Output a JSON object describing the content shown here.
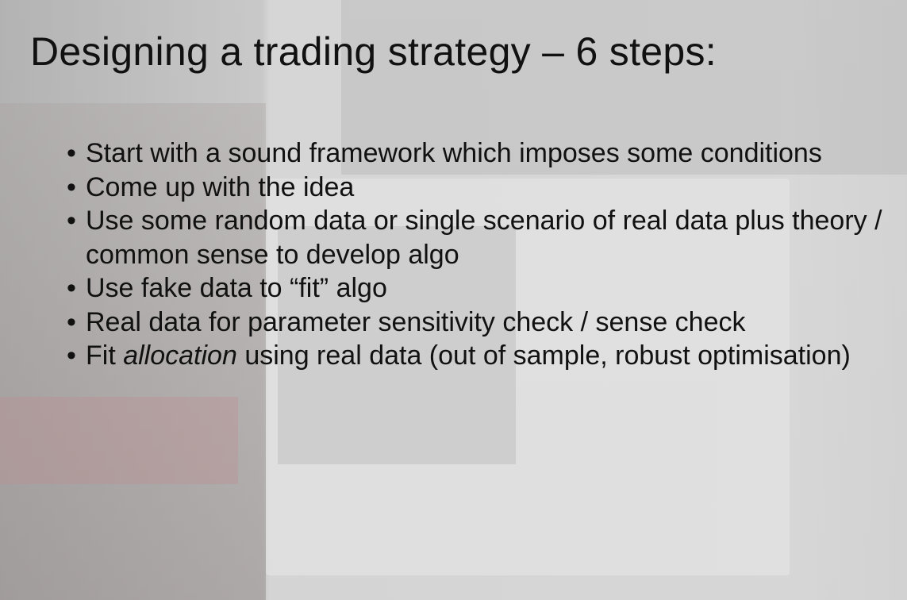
{
  "slide": {
    "title": "Designing a trading strategy – 6 steps:",
    "bullets": [
      {
        "text": "Start with a sound framework which imposes some conditions"
      },
      {
        "text": "Come up with the idea"
      },
      {
        "text": "Use some random data or single scenario of real data plus theory / common sense to develop algo"
      },
      {
        "text": "Use fake data to “fit” algo"
      },
      {
        "text": "Real data for parameter sensitivity check / sense check"
      },
      {
        "prefix": "Fit ",
        "emphasis": "allocation",
        "suffix": " using real data (out of sample, robust optimisation)"
      }
    ],
    "bullet_glyph": "•"
  }
}
